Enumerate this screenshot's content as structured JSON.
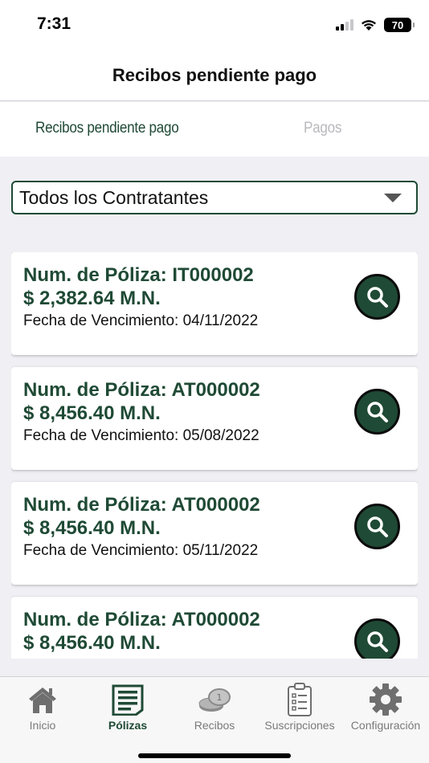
{
  "status_bar": {
    "time": "7:31",
    "battery": "70",
    "icons": [
      "signal-icon",
      "wifi-icon",
      "battery-icon"
    ]
  },
  "header": {
    "title": "Recibos pendiente pago"
  },
  "segments": [
    {
      "label": "Recibos pendiente pago",
      "active": true
    },
    {
      "label": "Pagos",
      "active": false
    }
  ],
  "filter": {
    "selected": "Todos los Contratantes"
  },
  "receipts": [
    {
      "policy": "Num. de Póliza: IT000002",
      "amount": "$ 2,382.64 M.N.",
      "due": "Fecha de Vencimiento: 04/11/2022"
    },
    {
      "policy": "Num. de Póliza: AT000002",
      "amount": "$ 8,456.40 M.N.",
      "due": "Fecha de Vencimiento: 05/08/2022"
    },
    {
      "policy": "Num. de Póliza: AT000002",
      "amount": "$ 8,456.40 M.N.",
      "due": "Fecha de Vencimiento: 05/11/2022"
    },
    {
      "policy": "Num. de Póliza: AT000002",
      "amount": "$ 8,456.40 M.N.",
      "due": ""
    }
  ],
  "tabs": [
    {
      "label": "Inicio",
      "icon": "home-icon",
      "active": false
    },
    {
      "label": "Pólizas",
      "icon": "policies-icon",
      "active": true
    },
    {
      "label": "Recibos",
      "icon": "coins-icon",
      "active": false
    },
    {
      "label": "Suscripciones",
      "icon": "clipboard-icon",
      "active": false
    },
    {
      "label": "Configuración",
      "icon": "gear-icon",
      "active": false
    }
  ],
  "colors": {
    "primary": "#1f4a35",
    "inactive": "#7a7a7a",
    "background": "#efeff4"
  }
}
